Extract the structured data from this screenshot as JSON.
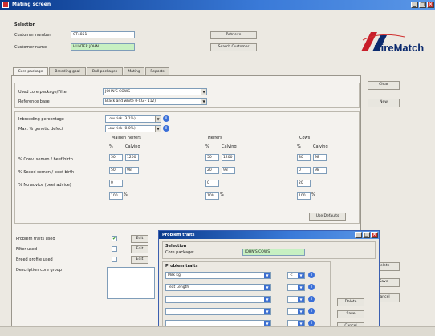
{
  "window": {
    "title": "Mating screen"
  },
  "selection": {
    "heading": "Selection",
    "customer_number_label": "Customer number",
    "customer_number_value": "CT4851",
    "customer_name_label": "Customer name",
    "customer_name_value": "HUNTER JOHN",
    "retrieve_button": "Retrieve",
    "search_customer_button": "Search Customer"
  },
  "logo": {
    "text": "SireMatch"
  },
  "tabs": [
    "Core package",
    "Breeding goal",
    "Bull packages",
    "Mating",
    "Reports"
  ],
  "core": {
    "used_core_label": "Used core package/Filter",
    "used_core_value": "JOHN'S COWS",
    "reference_base_label": "Reference base",
    "reference_base_value": "Black and white (FCG - 112)",
    "inbreeding_label": "Inbreeding percentage",
    "inbreeding_value": "Low risk (3.1%)",
    "max_genetic_label": "Max. % genetic defect",
    "max_genetic_value": "Low risk (0.0%)",
    "groups": [
      {
        "name": "Maiden heifers",
        "cols": [
          "%",
          "Calving"
        ],
        "r1": [
          "50",
          "1200"
        ],
        "r2": [
          "50",
          "98"
        ],
        "r3": "0",
        "r4": "100"
      },
      {
        "name": "Heifers",
        "cols": [
          "%",
          "Calving"
        ],
        "r1": [
          "50",
          "1200"
        ],
        "r2": [
          "20",
          "98"
        ],
        "r3": "0",
        "r4": "100"
      },
      {
        "name": "Cows",
        "cols": [
          "%",
          "Calving"
        ],
        "r1": [
          "80",
          "98"
        ],
        "r2": [
          "0",
          "98"
        ],
        "r3": "20",
        "r4": "100"
      }
    ],
    "row_labels": [
      "% Conv. semen / beef birth",
      "% Sexed semen / beef birth",
      "% No advice (beef advice)"
    ],
    "percent_sign": "%",
    "use_defaults_button": "Use Defaults",
    "problem_traits_label": "Problem traits used",
    "filter_used_label": "Filter used",
    "breed_profile_label": "Breed profile used",
    "description_label": "Description core group",
    "edit_label": "Edit",
    "check_mark": "✔"
  },
  "right_buttons": {
    "clear": "Clear",
    "new": "New",
    "delete": "Delete",
    "save": "Save",
    "cancel": "Cancel"
  },
  "dialog": {
    "title": "Problem traits",
    "selection_heading": "Selection",
    "core_package_label": "Core package:",
    "core_package_value": "JOHN'S COWS",
    "problem_traits_heading": "Problem traits",
    "traits": [
      {
        "name": "Milk kg",
        "op": "<"
      },
      {
        "name": "Teat Length",
        "op": ""
      },
      {
        "name": "",
        "op": ""
      },
      {
        "name": "",
        "op": ""
      },
      {
        "name": "",
        "op": ""
      }
    ],
    "delete_button": "Delete",
    "save_button": "Save",
    "cancel_button": "Cancel"
  },
  "colors": {
    "title_bar": "#0a3a8c",
    "accent_blue": "#3a6fd8",
    "green_field": "#c7f0c2",
    "logo_red": "#c81e2a",
    "logo_blue": "#0b2a6e"
  }
}
